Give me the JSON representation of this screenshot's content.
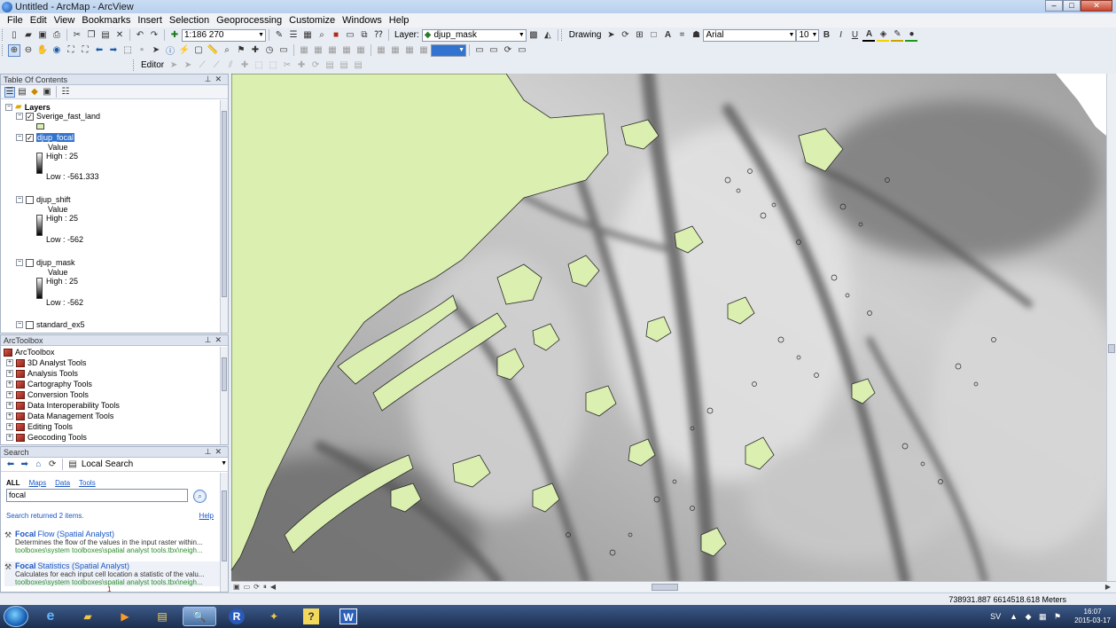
{
  "window": {
    "title": "Untitled - ArcMap - ArcView"
  },
  "menu": [
    "File",
    "Edit",
    "View",
    "Bookmarks",
    "Insert",
    "Selection",
    "Geoprocessing",
    "Customize",
    "Windows",
    "Help"
  ],
  "toolbar": {
    "scale": "1:186 270",
    "layer_label": "Layer:",
    "layer_value": "djup_mask",
    "drawing_label": "Drawing",
    "font_name": "Arial",
    "font_size": "10",
    "bold": "B",
    "italic": "I",
    "underline": "U",
    "editor_label": "Editor"
  },
  "toc": {
    "title": "Table Of Contents",
    "root": "Layers",
    "layers": [
      {
        "name": "Sverige_fast_land",
        "checked": true
      },
      {
        "name": "djup_focal",
        "checked": true,
        "value_label": "Value",
        "high": "High : 25",
        "low": "Low : -561.333"
      },
      {
        "name": "djup_shift",
        "checked": false,
        "value_label": "Value",
        "high": "High : 25",
        "low": "Low : -562"
      },
      {
        "name": "djup_mask",
        "checked": false,
        "value_label": "Value",
        "high": "High : 25",
        "low": "Low : -562"
      },
      {
        "name": "standard_ex5",
        "checked": false
      }
    ]
  },
  "arctoolbox": {
    "title": "ArcToolbox",
    "root": "ArcToolbox",
    "items": [
      "3D Analyst Tools",
      "Analysis Tools",
      "Cartography Tools",
      "Conversion Tools",
      "Data Interoperability Tools",
      "Data Management Tools",
      "Editing Tools",
      "Geocoding Tools"
    ]
  },
  "search": {
    "title": "Search",
    "scope": "Local Search",
    "filters": {
      "all": "ALL",
      "maps": "Maps",
      "data": "Data",
      "tools": "Tools"
    },
    "query": "focal",
    "result_count": "Search returned 2 items.",
    "help": "Help",
    "results": [
      {
        "bold": "Focal",
        "rest": "Flow (Spatial Analyst)",
        "desc": "Determines the flow of the values in the input raster within...",
        "path": "toolboxes\\system toolboxes\\spatial analyst tools.tbx\\neigh..."
      },
      {
        "bold": "Focal",
        "rest": "Statistics (Spatial Analyst)",
        "desc": "Calculates for each input cell location a statistic of the valu...",
        "path": "toolboxes\\system toolboxes\\spatial analyst tools.tbx\\neigh..."
      }
    ]
  },
  "status": {
    "coords": "738931.887  6614518.618 Meters",
    "page": "1"
  },
  "taskbar": {
    "lang": "SV",
    "time": "16:07",
    "date": "2015-03-17",
    "word_label": "W",
    "r_label": "R",
    "help_label": "?"
  },
  "colors": {
    "land": "#dbefb0",
    "land_stroke": "#2b2b2b",
    "selection": "#3273cf"
  }
}
